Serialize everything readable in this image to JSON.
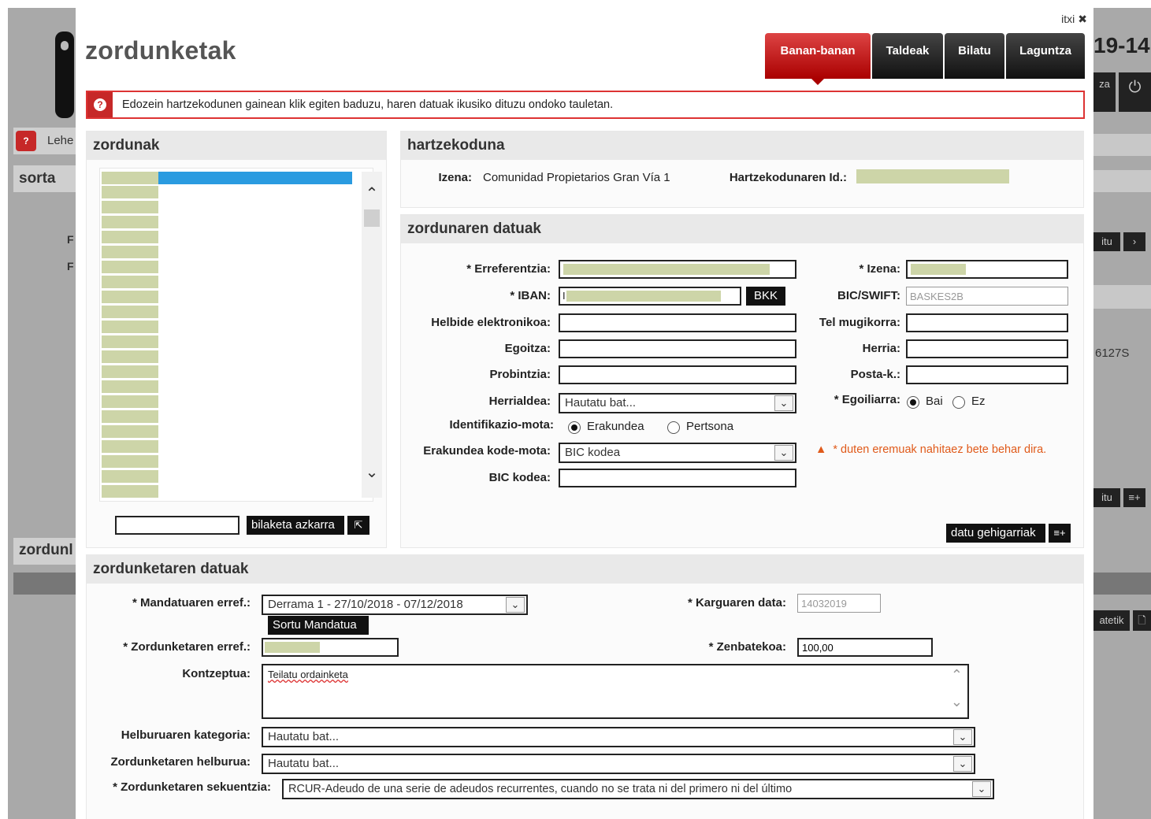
{
  "background": {
    "sidebar_tab_label": "Lehe",
    "section_sorta": "sorta",
    "section_zordun": "zordunl",
    "letter_f1": "F",
    "letter_f2": "F",
    "right_header": "19-14",
    "right_btn_za": "za",
    "right_btn_itu1": "itu",
    "right_value": "6127S",
    "right_btn_itu2": "itu",
    "right_btn_atetik": "atetik"
  },
  "modal": {
    "close_label": "itxi",
    "close_icon": "✖",
    "title": "zordunketak",
    "tabs": [
      "Banan-banan",
      "Taldeak",
      "Bilatu",
      "Laguntza"
    ],
    "active_tab": "Banan-banan",
    "notice_icon": "?",
    "notice_text": "Edozein hartzekodunen gainean klik egiten baduzu, haren datuak ikusiko dituzu ondoko tauletan."
  },
  "zordunak": {
    "title": "zordunak",
    "search_value": "",
    "search_button": "bilaketa azkarra",
    "export_icon": "⇱",
    "scroll_up": "⌃",
    "scroll_down": "⌄"
  },
  "hartzekoduna": {
    "title": "hartzekoduna",
    "izena_label": "Izena:",
    "izena_value": "Comunidad Propietarios Gran Vía 1",
    "id_label": "Hartzekodunaren Id.:"
  },
  "zordunaren_datuak": {
    "title": "zordunaren datuak",
    "erreferentzia_label": "* Erreferentzia:",
    "iban_label": "* IBAN:",
    "iban_prefix": "I",
    "bkk_button": "BKK",
    "helbide_label": "Helbide elektronikoa:",
    "egoitza_label": "Egoitza:",
    "probintzia_label": "Probintzia:",
    "herrialdea_label": "Herrialdea:",
    "herrialdea_value": "Hautatu bat...",
    "identifikazio_label": "Identifikazio-mota:",
    "ident_options": [
      "Erakundea",
      "Pertsona"
    ],
    "erakundea_kode_label": "Erakundea kode-mota:",
    "erakundea_kode_value": "BIC kodea",
    "bic_kodea_label": "BIC kodea:",
    "izena_label": "* Izena:",
    "bic_swift_label": "BIC/SWIFT:",
    "bic_swift_value": "BASKES2B",
    "tel_label": "Tel mugikorra:",
    "herria_label": "Herria:",
    "posta_label": "Posta-k.:",
    "egoiliarra_label": "* Egoiliarra:",
    "egoiliarra_options": [
      "Bai",
      "Ez"
    ],
    "warning_icon": "▲",
    "warning_text": "* duten eremuak nahitaez bete behar dira.",
    "more_button": "datu gehigarriak",
    "more_icon": "≡+"
  },
  "zordunketaren_datuak": {
    "title": "zordunketaren datuak",
    "mandatu_label": "* Mandatuaren erref.:",
    "mandatu_value": "Derrama 1 - 27/10/2018 - 07/12/2018",
    "sortu_button": "Sortu Mandatua",
    "karguaren_label": "* Karguaren data:",
    "karguaren_value": "14032019",
    "zordunketaren_erref_label": "* Zordunketaren erref.:",
    "zenbatekoa_label": "* Zenbatekoa:",
    "zenbatekoa_value": "100,00",
    "kontzeptua_label": "Kontzeptua:",
    "kontzeptua_value": "Teilatu ordainketa",
    "kategoria_label": "Helburuaren kategoria:",
    "kategoria_value": "Hautatu bat...",
    "helburua_label": "Zordunketaren helburua:",
    "helburua_value": "Hautatu bat...",
    "sekuentzia_label": "* Zordunketaren sekuentzia:",
    "sekuentzia_value": "RCUR-Adeudo de una serie de adeudos recurrentes, cuando no se trata ni del primero ni del último"
  }
}
